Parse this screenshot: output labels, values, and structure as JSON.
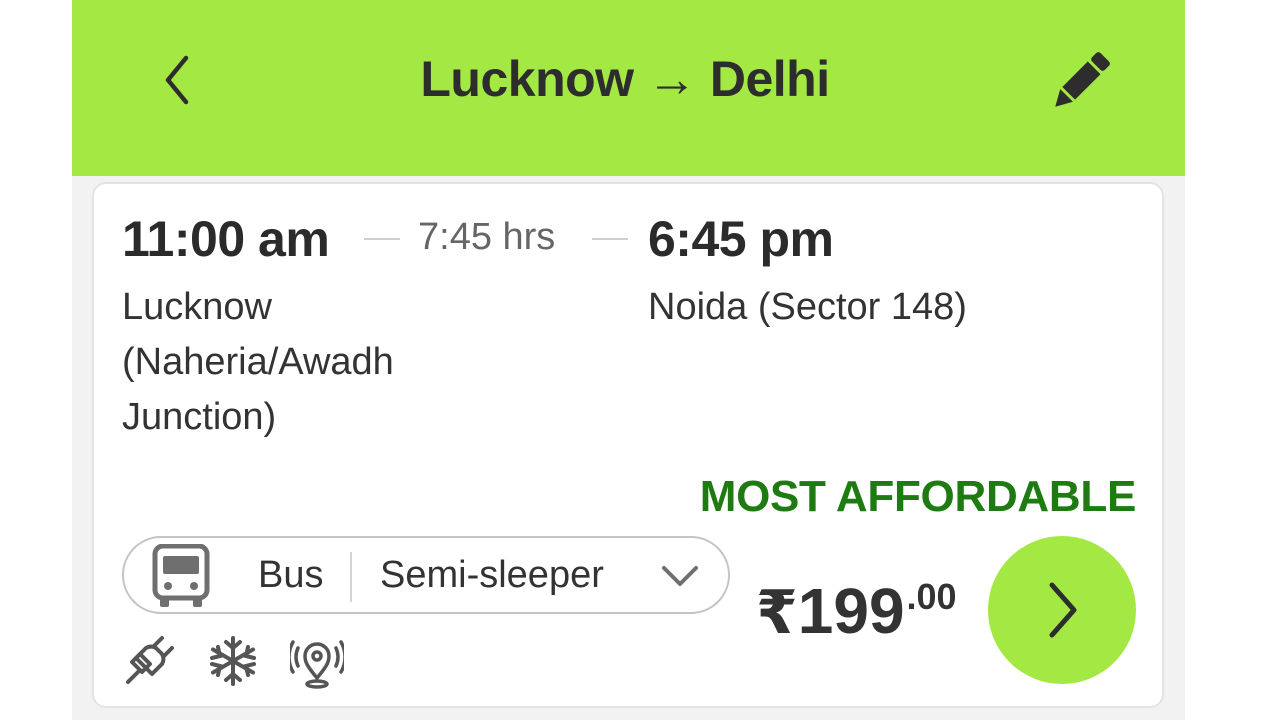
{
  "header": {
    "title": "Lucknow → Delhi",
    "back_icon": "chevron-left-icon",
    "edit_icon": "pencil-icon"
  },
  "trip": {
    "departure_time": "11:00 am",
    "duration": "7:45 hrs",
    "arrival_time": "6:45 pm",
    "departure_stop": "Lucknow (Naheria/Awadh Junction)",
    "arrival_stop": "Noida (Sector 148)",
    "tag": "MOST AFFORDABLE",
    "mode": "Bus",
    "mode_icon": "bus-icon",
    "bus_class": "Semi-sleeper",
    "class_dropdown_icon": "chevron-down-icon",
    "amenities": [
      "charging-plug-icon",
      "ac-snowflake-icon",
      "live-tracking-icon"
    ],
    "price": {
      "currency": "₹",
      "amount": "199",
      "decimals": ".00"
    },
    "proceed_icon": "chevron-right-icon"
  },
  "colors": {
    "brand_green": "#a4e843",
    "tag_green": "#1e7b12",
    "text_dark": "#2b2b2b"
  }
}
